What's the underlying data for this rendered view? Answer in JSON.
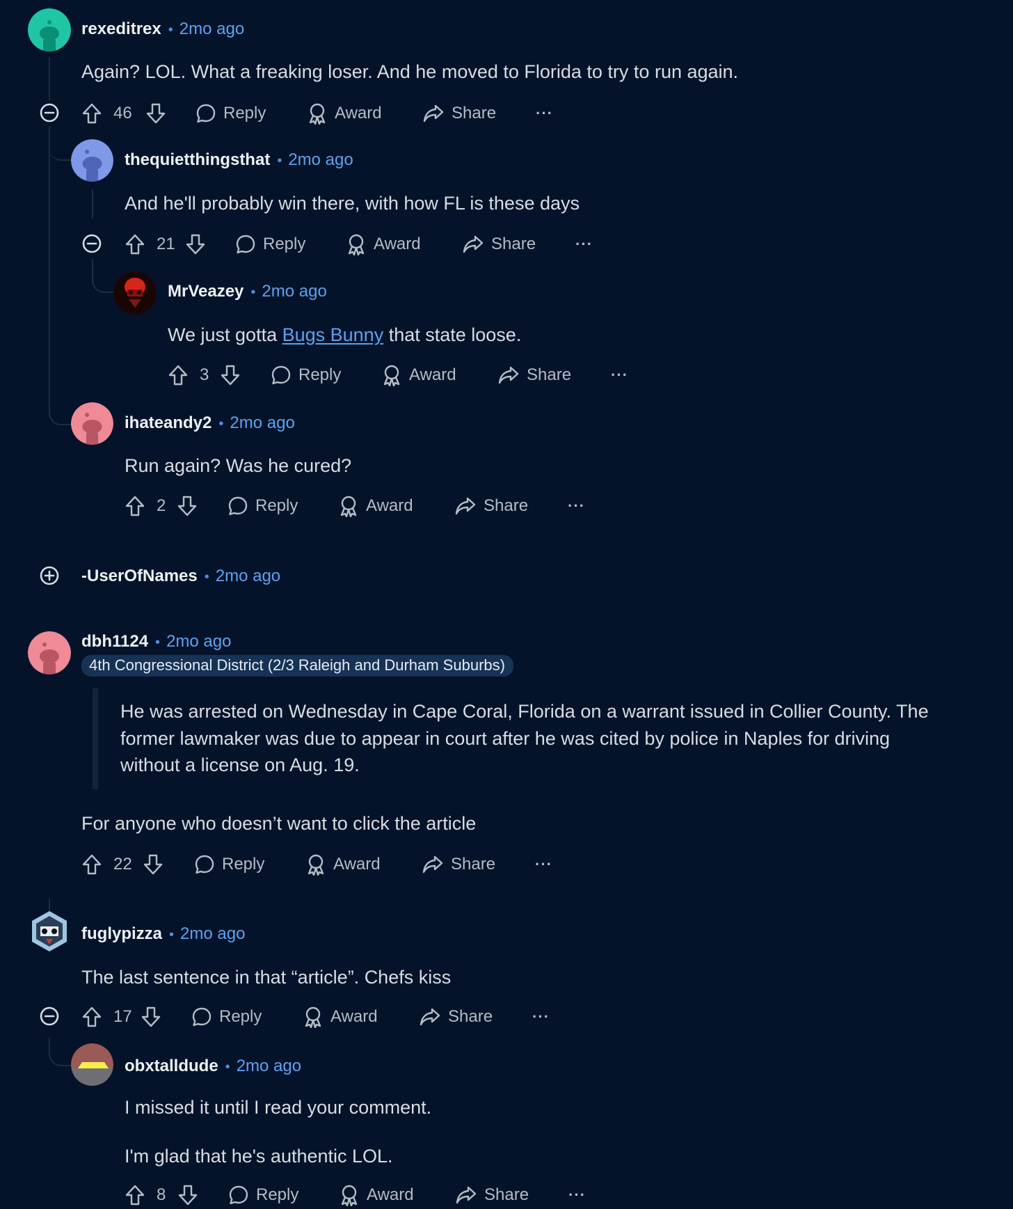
{
  "actions_labels": {
    "reply": "Reply",
    "award": "Award",
    "share": "Share",
    "more": "···"
  },
  "comments": [
    {
      "username": "rexeditrex",
      "time": "2mo ago",
      "avatar_color": "#1ec6a6",
      "text": "Again? LOL. What a freaking loser. And he moved to Florida to try to run again.",
      "votes": "46"
    },
    {
      "username": "thequietthingsthat",
      "time": "2mo ago",
      "avatar_color": "#7f98e8",
      "text": "And he'll probably win there, with how FL is these days",
      "votes": "21"
    },
    {
      "username": "MrVeazey",
      "time": "2mo ago",
      "avatar_color": "#c21d14",
      "text_before": "We just gotta ",
      "link_text": "Bugs Bunny",
      "text_after": " that state loose.",
      "votes": "3"
    },
    {
      "username": "ihateandy2",
      "time": "2mo ago",
      "avatar_color": "#f08a96",
      "text": "Run again? Was he cured?",
      "votes": "2"
    },
    {
      "username": "-UserOfNames",
      "time": "2mo ago",
      "collapsed": true
    },
    {
      "username": "dbh1124",
      "time": "2mo ago",
      "avatar_color": "#f08a96",
      "flair": "4th Congressional District (2/3 Raleigh and Durham Suburbs)",
      "quote_lines": [
        "He was arrested on Wednesday in Cape Coral, Florida on a warrant issued in Collier County. The",
        "former lawmaker was due to appear in court after he was cited by police in Naples for driving",
        "without a license on Aug. 19."
      ],
      "text": "For anyone who doesn’t want to click the article",
      "votes": "22"
    },
    {
      "username": "fuglypizza",
      "time": "2mo ago",
      "avatar_color": "#3b7fb6",
      "text": "The last sentence in that “article”. Chefs kiss",
      "votes": "17"
    },
    {
      "username": "obxtalldude",
      "time": "2mo ago",
      "avatar_color": "#9b5a56",
      "text_lines": [
        "I missed it until I read your comment.",
        "I'm glad that he's authentic LOL."
      ],
      "votes": "8"
    }
  ]
}
